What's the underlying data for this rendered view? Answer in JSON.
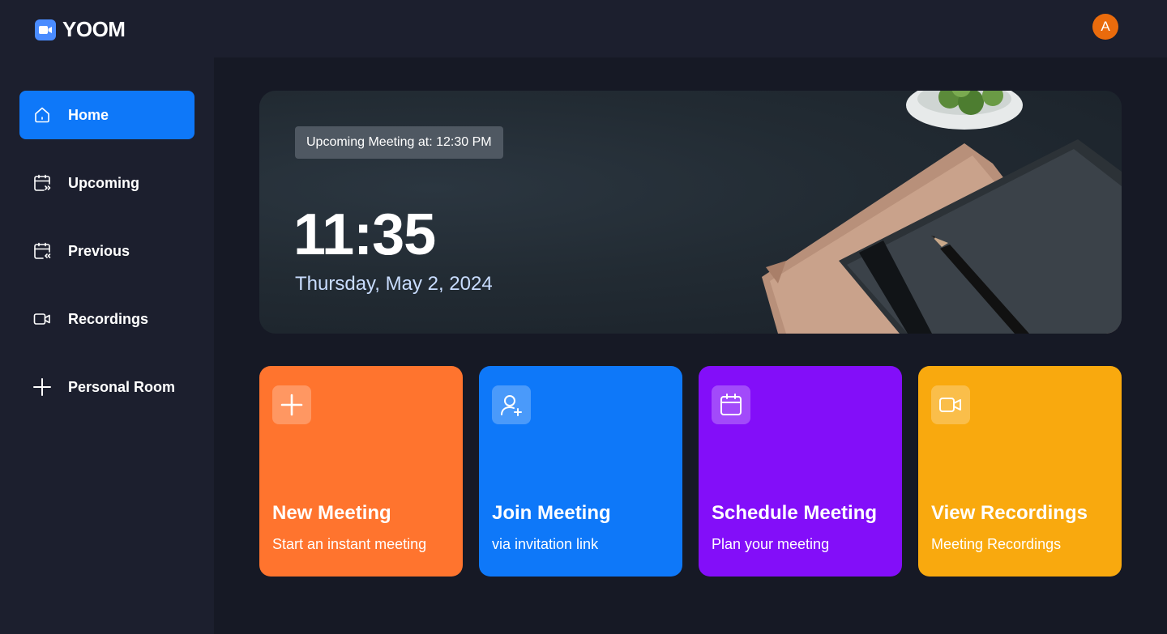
{
  "app": {
    "name": "YOOM",
    "logo_icon": "video-camera-icon"
  },
  "header": {
    "avatar_initial": "A",
    "avatar_color": "#ea6b0c"
  },
  "sidebar": {
    "items": [
      {
        "label": "Home",
        "icon": "home-icon",
        "active": true
      },
      {
        "label": "Upcoming",
        "icon": "calendar-upcoming-icon",
        "active": false
      },
      {
        "label": "Previous",
        "icon": "calendar-previous-icon",
        "active": false
      },
      {
        "label": "Recordings",
        "icon": "video-icon",
        "active": false
      },
      {
        "label": "Personal Room",
        "icon": "plus-icon",
        "active": false
      }
    ]
  },
  "hero": {
    "upcoming": "Upcoming Meeting at: 12:30 PM",
    "time": "11:35",
    "date": "Thursday, May 2, 2024"
  },
  "cards": [
    {
      "title": "New Meeting",
      "subtitle": "Start an instant meeting",
      "icon": "plus-icon",
      "color": "#ff742e"
    },
    {
      "title": "Join Meeting",
      "subtitle": "via invitation link",
      "icon": "add-user-icon",
      "color": "#0e78f9"
    },
    {
      "title": "Schedule Meeting",
      "subtitle": "Plan your meeting",
      "icon": "calendar-icon",
      "color": "#830ef9"
    },
    {
      "title": "View Recordings",
      "subtitle": "Meeting Recordings",
      "icon": "video-icon",
      "color": "#f9a90e"
    }
  ],
  "colors": {
    "accent": "#0e78f9",
    "background": "#161925",
    "panel": "#1c1f2e"
  }
}
